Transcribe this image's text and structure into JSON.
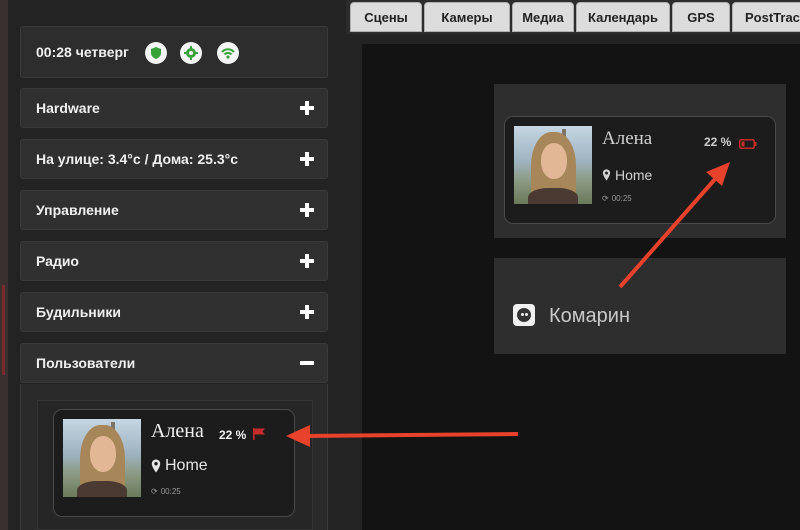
{
  "status": {
    "time": "00:28 четверг",
    "icons": [
      "shield-icon",
      "gear-icon",
      "wifi-icon"
    ],
    "icon_color": "#3aa23a"
  },
  "sidebar": {
    "items": [
      {
        "label": "Hardware",
        "state": "collapsed"
      },
      {
        "label": "На улице: 3.4°c / Дома: 25.3°c",
        "state": "collapsed"
      },
      {
        "label": "Управление",
        "state": "collapsed"
      },
      {
        "label": "Радио",
        "state": "collapsed"
      },
      {
        "label": "Будильники",
        "state": "collapsed"
      },
      {
        "label": "Пользователи",
        "state": "expanded"
      }
    ]
  },
  "user_card": {
    "name": "Алена",
    "battery": "22 %",
    "location": "Home",
    "updated": "00:25"
  },
  "tabs": [
    "Сцены",
    "Камеры",
    "Медиа",
    "Календарь",
    "GPS",
    "PostTrac"
  ],
  "main": {
    "card": {
      "name": "Алена",
      "battery": "22 %",
      "location": "Home",
      "updated": "00:25"
    },
    "room": {
      "label": "Комарин"
    }
  },
  "colors": {
    "arrow": "#e8412c",
    "battery_low": "#c62b2b"
  }
}
